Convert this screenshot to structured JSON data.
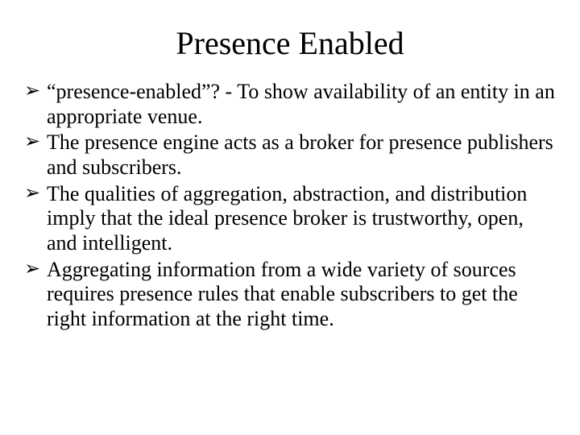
{
  "title": "Presence Enabled",
  "marker": "➢",
  "bullets": [
    "“presence-enabled”? - To show availability of an entity in an appropriate venue.",
    "The presence engine acts as a broker for presence publishers and subscribers.",
    "The qualities of aggregation, abstraction, and distribution imply that the ideal presence broker is trustworthy, open, and intelligent.",
    "Aggregating information from a wide variety of sources requires presence rules that enable subscribers to get the right information at the right time."
  ]
}
